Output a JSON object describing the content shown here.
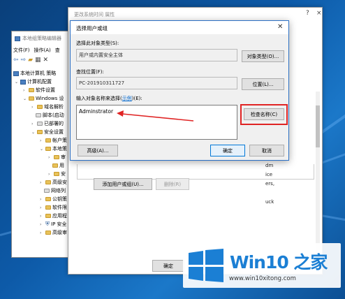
{
  "group_policy_window": {
    "title": "本地组策略编辑器",
    "menu": [
      "文件(F)",
      "操作(A)",
      "查"
    ],
    "toolbar_icons": [
      "back-arrow-icon",
      "forward-arrow-icon",
      "folder-icon",
      "console-tree-icon",
      "delete-icon"
    ],
    "tree": [
      {
        "label": "本地计算机 策略",
        "icon": "computer-icon"
      },
      {
        "label": "计算机配置",
        "icon": "computer-icon"
      },
      {
        "label": "软件设置",
        "icon": "folder-icon"
      },
      {
        "label": "Windows 设",
        "icon": "folder-icon"
      },
      {
        "label": "域名解析",
        "icon": "folder-icon"
      },
      {
        "label": "脚本(启动",
        "icon": "folder-icon"
      },
      {
        "label": "已部署的",
        "icon": "folder-icon"
      },
      {
        "label": "安全设置",
        "icon": "folder-icon"
      },
      {
        "label": "帐户策",
        "icon": "folder-icon"
      },
      {
        "label": "本地策",
        "icon": "folder-icon"
      },
      {
        "label": "审",
        "icon": "folder-icon"
      },
      {
        "label": "用",
        "icon": "folder-icon"
      },
      {
        "label": "安",
        "icon": "folder-icon"
      },
      {
        "label": "高级安",
        "icon": "folder-icon"
      },
      {
        "label": "网络列",
        "icon": "folder-icon"
      },
      {
        "label": "公钥策",
        "icon": "folder-icon"
      },
      {
        "label": "软件限",
        "icon": "folder-icon"
      },
      {
        "label": "应用程",
        "icon": "folder-icon"
      },
      {
        "label": "IP 安全",
        "icon": "shield-icon"
      },
      {
        "label": "高级审",
        "icon": "folder-icon"
      }
    ]
  },
  "properties_window": {
    "title": "更改系统时间 属性",
    "help_glyph": "?",
    "close_glyph": "×",
    "right_list": [
      "dm",
      "ice",
      "ers,",
      "",
      "uck"
    ],
    "add_button": "添加用户或组(U)...",
    "remove_button": "删除(R)",
    "ok_button": "确定"
  },
  "dialog": {
    "title": "选择用户或组",
    "close_glyph": "✕",
    "object_type_label": "选择此对象类型(S):",
    "object_type_value": "用户或内置安全主体",
    "object_type_button": "对象类型(O)...",
    "location_label": "查找位置(F):",
    "location_value": "PC-201910311727",
    "location_button": "位置(L)...",
    "names_label_prefix": "输入对象名称来选择(",
    "names_label_link": "示例",
    "names_label_suffix": ")(E):",
    "names_value": "Adminstrator",
    "check_names_button": "检查名称(C)",
    "advanced_button": "高级(A)...",
    "ok_button": "确定",
    "cancel_button": "取消",
    "annotation_color": "#e02424"
  },
  "watermark": {
    "brand": "Win10 之家",
    "url": "www.win10xitong.com",
    "logo_icon": "windows-logo-icon"
  }
}
